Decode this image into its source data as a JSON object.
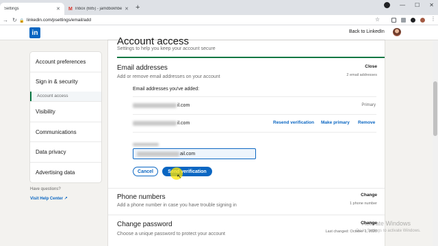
{
  "browser": {
    "tabs": [
      {
        "title": "Settings",
        "active": true
      },
      {
        "title": "Inbox (685) - jamdbokhber1@g...",
        "active": false
      }
    ],
    "url": "linkedin.com/psettings/email/add"
  },
  "header": {
    "logo": "in",
    "back_link": "Back to LinkedIn"
  },
  "left_nav": {
    "items": [
      {
        "label": "Account preferences"
      },
      {
        "label": "Sign in & security"
      },
      {
        "label": "Visibility"
      },
      {
        "label": "Communications"
      },
      {
        "label": "Data privacy"
      },
      {
        "label": "Advertising data"
      }
    ],
    "active_sub": "Account access",
    "help_question": "Have questions?",
    "help_link": "Visit Help Center"
  },
  "main": {
    "heading": "Account access",
    "subheading": "Settings to help you keep your account secure",
    "email_section": {
      "title": "Email addresses",
      "desc": "Add or remove email addresses on your account",
      "action": "Close",
      "meta": "2 email addresses",
      "added_label": "Email addresses you've added:",
      "rows": [
        {
          "suffix": "il.com",
          "tag": "Primary"
        },
        {
          "suffix": "il.com",
          "resend": "Resend verification",
          "make_primary": "Make primary",
          "remove": "Remove"
        }
      ],
      "input_suffix": "ail.com",
      "cancel_label": "Cancel",
      "send_label": "Send verification"
    },
    "phone_section": {
      "title": "Phone numbers",
      "desc": "Add a phone number in case you have trouble signing in",
      "action": "Change",
      "meta": "1 phone number"
    },
    "password_section": {
      "title": "Change password",
      "desc": "Choose a unique password to protect your account",
      "action": "Change",
      "meta": "Last changed: October 1, 2020"
    }
  },
  "watermark": {
    "line1": "Activate Windows",
    "line2": "Go to Settings to activate Windows."
  },
  "colors": {
    "brand": "#0a66c2",
    "accent_green": "#057642",
    "page_bg": "#f3f2ef"
  }
}
